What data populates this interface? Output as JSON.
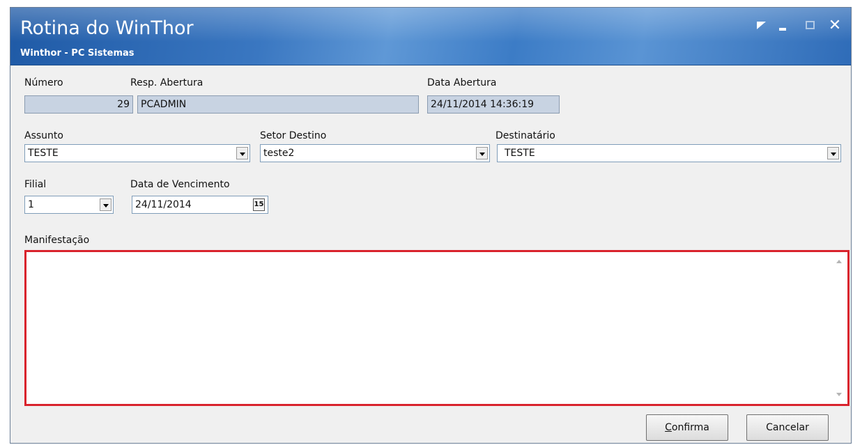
{
  "window": {
    "title": "Rotina do WinThor",
    "subtitle": "Winthor - PC Sistemas"
  },
  "icons": [
    "restore-icon",
    "minimize-icon",
    "maximize-icon",
    "close-icon",
    "calendar-icon",
    "chevron-down-icon",
    "scroll-up-icon",
    "scroll-down-icon"
  ],
  "form": {
    "numero": {
      "label": "Número",
      "value": "29"
    },
    "resp_abertura": {
      "label": "Resp. Abertura",
      "value": "PCADMIN"
    },
    "data_abertura": {
      "label": "Data Abertura",
      "value": "24/11/2014 14:36:19"
    },
    "assunto": {
      "label": "Assunto",
      "value": "TESTE"
    },
    "setor_destino": {
      "label": "Setor Destino",
      "value": "teste2"
    },
    "destinatario": {
      "label": "Destinatário",
      "value": "TESTE"
    },
    "filial": {
      "label": "Filial",
      "value": "1"
    },
    "data_vencimento": {
      "label": "Data de Vencimento",
      "value": "24/11/2014",
      "calendar_glyph": "15"
    },
    "manifestacao": {
      "label": "Manifestação",
      "value": ""
    }
  },
  "buttons": {
    "confirma_mnemonic": "C",
    "confirma_rest": "onfirma",
    "cancelar": "Cancelar"
  },
  "colors": {
    "titlebar": "#3a77c1",
    "highlight_border": "#d9232d",
    "readonly_field": "#c8d3e2"
  }
}
